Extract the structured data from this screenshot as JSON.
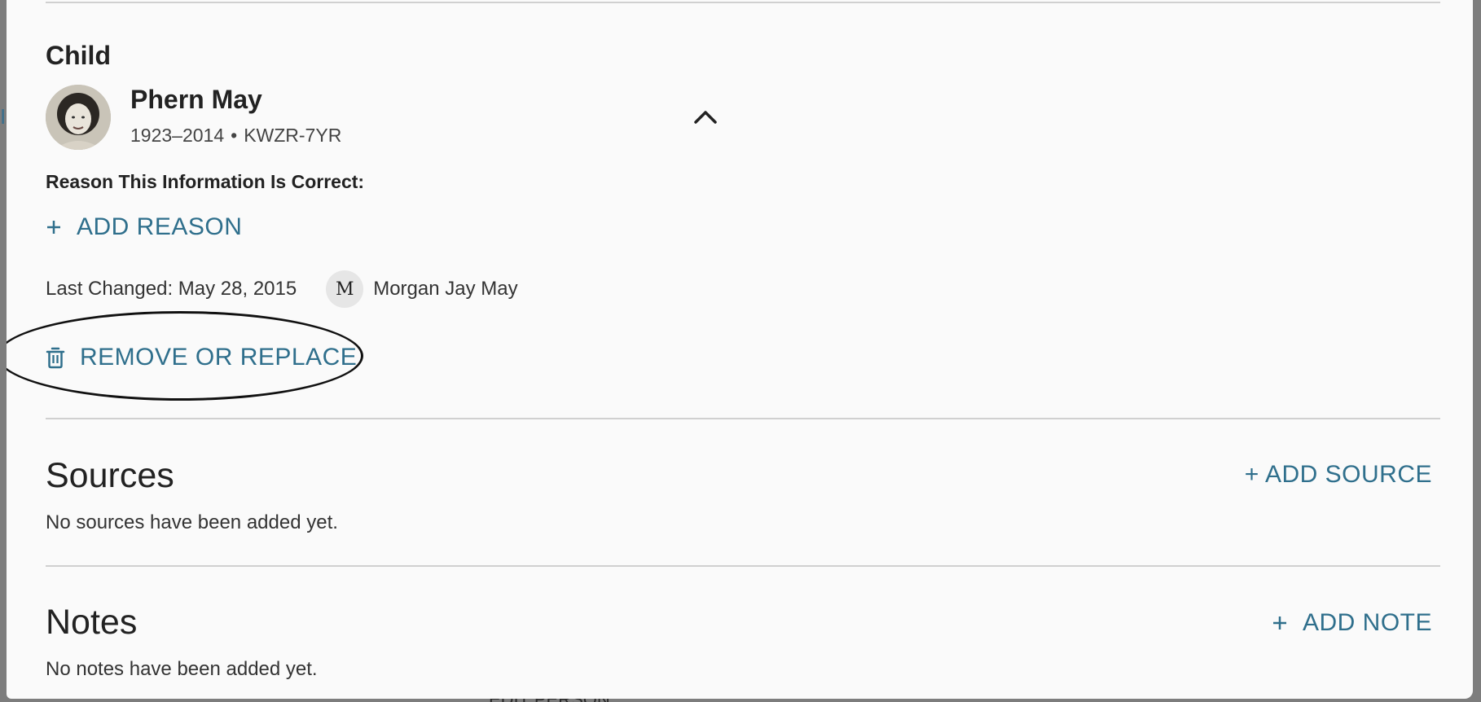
{
  "backdrop": {
    "left_fragment": "I",
    "bottom_fragment": "EDIT PERSON"
  },
  "child_section": {
    "heading": "Child",
    "person": {
      "name": "Phern May",
      "years": "1923–2014",
      "separator": "•",
      "id": "KWZR-7YR"
    },
    "reason_label": "Reason This Information Is Correct:",
    "add_reason_label": "ADD REASON",
    "last_changed": "Last Changed: May 28, 2015",
    "contributor": {
      "initial": "M",
      "name": "Morgan Jay May"
    },
    "remove_label": "REMOVE OR REPLACE"
  },
  "sources": {
    "title": "Sources",
    "add_label": "+ ADD SOURCE",
    "empty_text": "No sources have been added yet."
  },
  "notes": {
    "title": "Notes",
    "add_label": "ADD NOTE",
    "empty_text": "No notes have been added yet."
  },
  "colors": {
    "link": "#2f6f8c",
    "text": "#222222",
    "panel_bg": "#fafafa",
    "backdrop": "#7d7d7d",
    "annotation": "#111111"
  },
  "icons": {
    "collapse": "chevron-up-icon",
    "add": "plus-icon",
    "remove": "trash-icon"
  }
}
